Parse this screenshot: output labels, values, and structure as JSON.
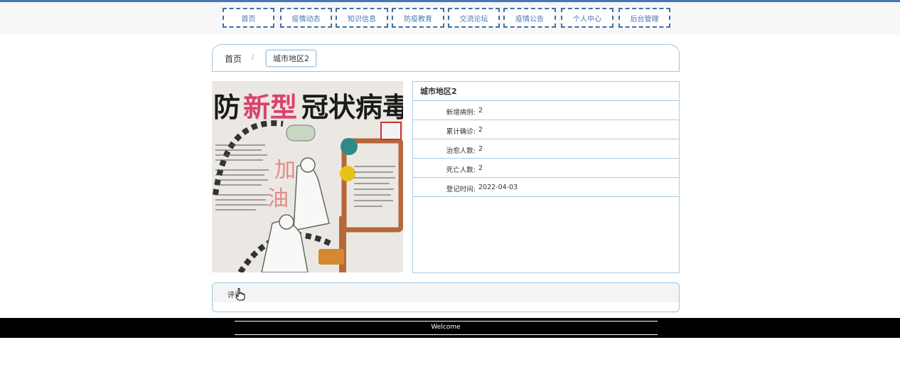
{
  "nav": {
    "items": [
      "首页",
      "疫情动态",
      "知识信息",
      "防疫教育",
      "交流论坛",
      "疫情公告",
      "个人中心",
      "后台管理"
    ]
  },
  "breadcrumb": {
    "home": "首页",
    "separator": "/",
    "current": "城市地区2"
  },
  "poster": {
    "title_part1": "防",
    "title_part2": "新型",
    "title_part3": "冠状病毒",
    "side_text_1": "加",
    "side_text_2": "油"
  },
  "detail": {
    "title": "城市地区2",
    "rows": [
      {
        "label": "新增病例:",
        "value": "2"
      },
      {
        "label": "累计确诊:",
        "value": "2"
      },
      {
        "label": "治愈人数:",
        "value": "2"
      },
      {
        "label": "死亡人数:",
        "value": "2"
      },
      {
        "label": "登记时间:",
        "value": "2022-04-03"
      }
    ]
  },
  "comment": {
    "label": "评论"
  },
  "footer": {
    "text": "Welcome"
  },
  "colors": {
    "nav_border": "#3f6fa8",
    "nav_text": "#4a77b4",
    "panel_border": "#a9cde6",
    "footer_bg": "#000000"
  }
}
